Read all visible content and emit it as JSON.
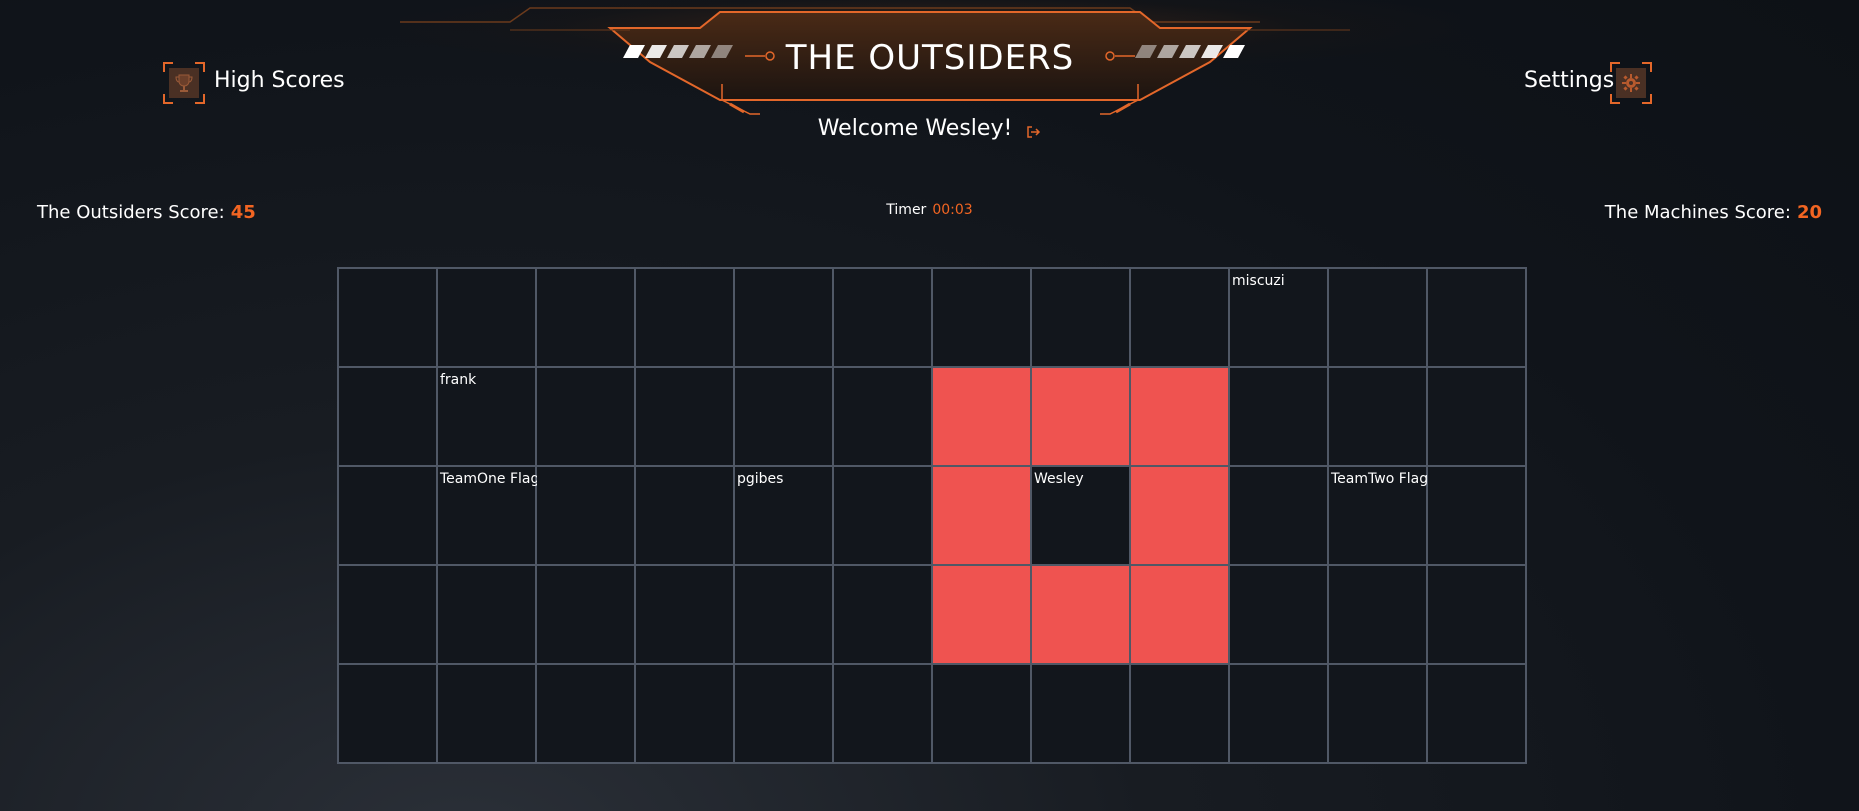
{
  "header": {
    "title": "THE OUTSIDERS",
    "welcome": "Welcome Wesley!",
    "high_scores_label": "High Scores",
    "settings_label": "Settings"
  },
  "scoreboard": {
    "team_one_label": "The Outsiders Score:",
    "team_one_score": "45",
    "timer_label": "Timer",
    "timer_value": "00:03",
    "team_two_label": "The Machines Score:",
    "team_two_score": "20"
  },
  "colors": {
    "accent": "#f26522",
    "blocked_cell": "#ef5350",
    "grid_line": "#505866"
  },
  "icons": {
    "high_scores": "trophy-icon",
    "settings": "gear-icon",
    "logout": "logout-icon"
  },
  "board": {
    "rows": 5,
    "cols": 12,
    "labels": [
      {
        "row": 0,
        "col": 9,
        "text": "miscuzi"
      },
      {
        "row": 1,
        "col": 1,
        "text": "frank"
      },
      {
        "row": 2,
        "col": 1,
        "text": "TeamOne Flag"
      },
      {
        "row": 2,
        "col": 4,
        "text": "pgibes"
      },
      {
        "row": 2,
        "col": 7,
        "text": "Wesley"
      },
      {
        "row": 2,
        "col": 10,
        "text": "TeamTwo Flag"
      }
    ],
    "blocked": [
      [
        1,
        6
      ],
      [
        1,
        7
      ],
      [
        1,
        8
      ],
      [
        2,
        6
      ],
      [
        2,
        8
      ],
      [
        3,
        6
      ],
      [
        3,
        7
      ],
      [
        3,
        8
      ]
    ]
  }
}
